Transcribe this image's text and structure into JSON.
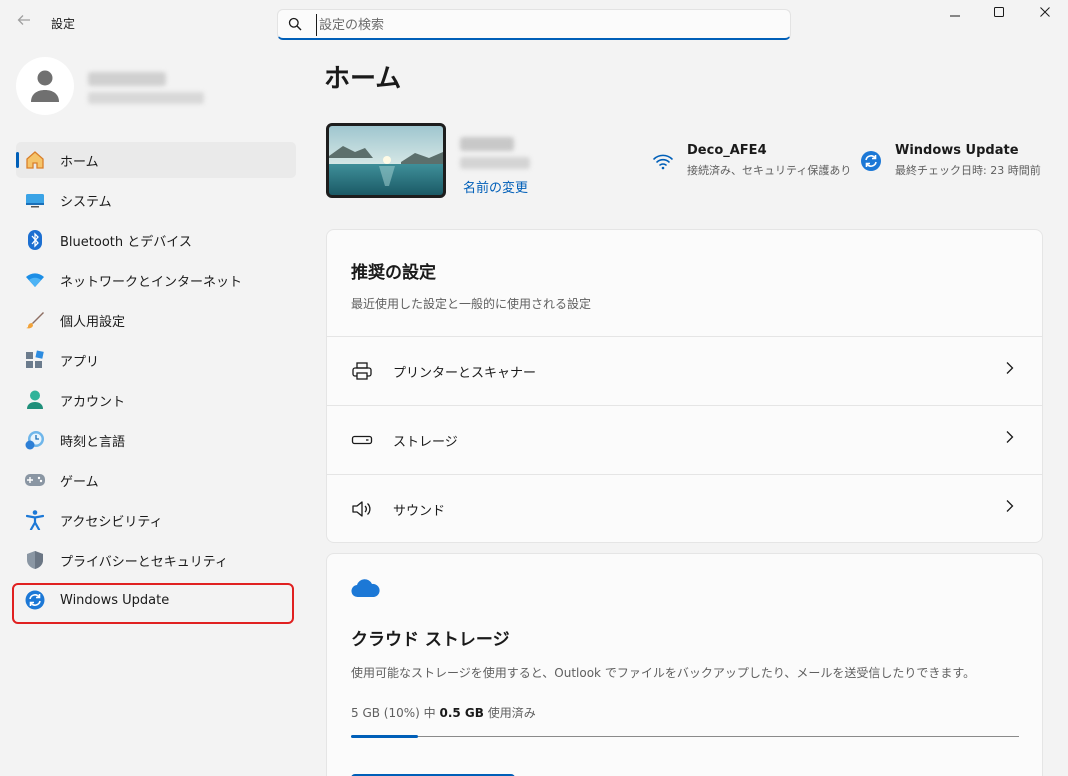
{
  "window": {
    "title": "設定",
    "minimize_glyph": "—",
    "maximize_glyph": "☐",
    "close_glyph": "✕"
  },
  "search": {
    "placeholder": "設定の検索",
    "value": ""
  },
  "profile": {
    "name": "yuko kohiro",
    "email": "kohiro@windows.org"
  },
  "sidebar": {
    "items": [
      {
        "label": "ホーム",
        "icon": "home-icon",
        "active": true
      },
      {
        "label": "システム",
        "icon": "system-icon"
      },
      {
        "label": "Bluetooth とデバイス",
        "icon": "bluetooth-icon"
      },
      {
        "label": "ネットワークとインターネット",
        "icon": "wifi-icon"
      },
      {
        "label": "個人用設定",
        "icon": "brush-icon"
      },
      {
        "label": "アプリ",
        "icon": "apps-icon"
      },
      {
        "label": "アカウント",
        "icon": "account-icon"
      },
      {
        "label": "時刻と言語",
        "icon": "time-language-icon"
      },
      {
        "label": "ゲーム",
        "icon": "gamepad-icon"
      },
      {
        "label": "アクセシビリティ",
        "icon": "accessibility-icon"
      },
      {
        "label": "プライバシーとセキュリティ",
        "icon": "shield-icon"
      },
      {
        "label": "Windows Update",
        "icon": "windows-update-icon",
        "highlighted": true
      }
    ]
  },
  "main": {
    "title": "ホーム",
    "device": {
      "name": "kohiro",
      "subtitle": "システム名",
      "rename_link": "名前の変更"
    },
    "network": {
      "name": "Deco_AFE4",
      "status": "接続済み、セキュリティ保護あり"
    },
    "update": {
      "name": "Windows Update",
      "status": "最終チェック日時: 23 時間前"
    },
    "recommended": {
      "title": "推奨の設定",
      "subtitle": "最近使用した設定と一般的に使用される設定",
      "rows": [
        {
          "label": "プリンターとスキャナー",
          "icon": "printer-icon"
        },
        {
          "label": "ストレージ",
          "icon": "storage-icon"
        },
        {
          "label": "サウンド",
          "icon": "speaker-icon"
        }
      ]
    },
    "cloud": {
      "title": "クラウド ストレージ",
      "description": "使用可能なストレージを使用すると、Outlook でファイルをバックアップしたり、メールを送受信したりできます。",
      "usage_prefix": "5 GB (10%) 中 ",
      "usage_amount": "0.5 GB",
      "usage_suffix": " 使用済み",
      "usage_fraction": 0.1
    }
  },
  "colors": {
    "accent": "#005fb8",
    "highlight": "#e02020",
    "background": "#f3f3f3"
  }
}
